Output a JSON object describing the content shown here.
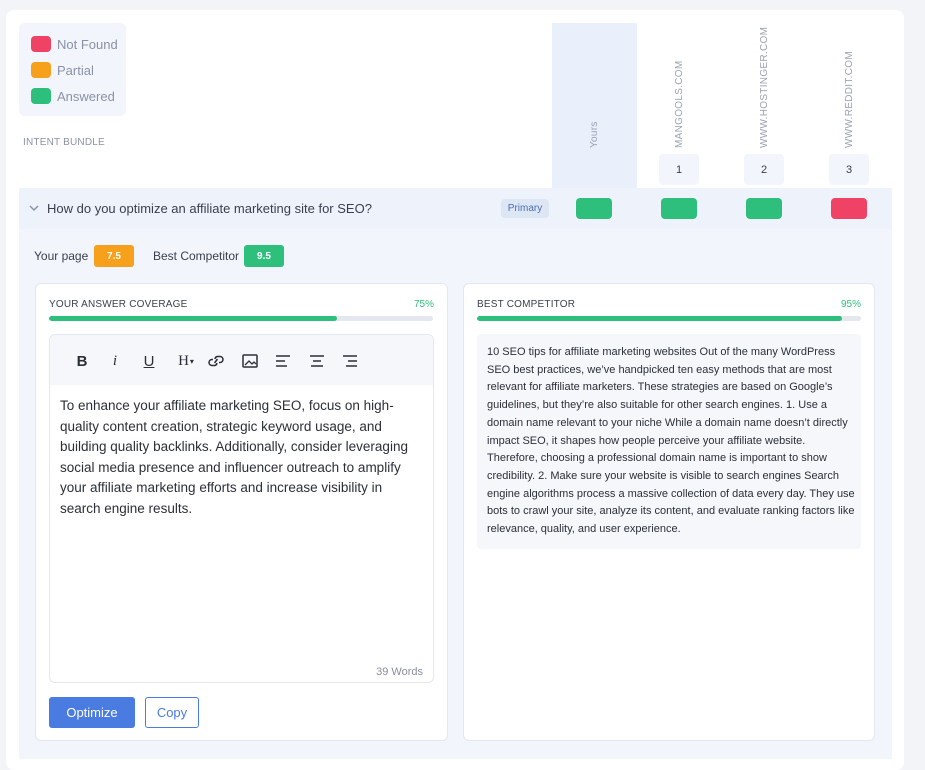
{
  "legend": {
    "items": [
      {
        "label": "Not Found",
        "color": "#ef4264"
      },
      {
        "label": "Partial",
        "color": "#f7a01c"
      },
      {
        "label": "Answered",
        "color": "#2fbf7c"
      }
    ]
  },
  "intent_bundle_label": "INTENT BUNDLE",
  "columns": {
    "yours": "Yours",
    "competitors": [
      {
        "site": "MANGOOLS.COM",
        "rank": "1"
      },
      {
        "site": "WWW.HOSTINGER.COM",
        "rank": "2"
      },
      {
        "site": "WWW.REDDIT.COM",
        "rank": "3"
      }
    ]
  },
  "question": {
    "text": "How do you optimize an affiliate marketing site for SEO?",
    "badge": "Primary",
    "statuses": [
      "answered",
      "answered",
      "answered",
      "not-found"
    ]
  },
  "scores": {
    "your_page_label": "Your page",
    "your_page_score": "7.5",
    "best_competitor_label": "Best Competitor",
    "best_competitor_score": "9.5"
  },
  "answer_panel": {
    "title": "YOUR ANSWER COVERAGE",
    "percent_label": "75%",
    "coverage": 0.75,
    "toolbar": [
      "bold-icon",
      "italic-icon",
      "underline-icon",
      "heading-icon",
      "link-icon",
      "image-icon",
      "align-left-icon",
      "align-center-icon",
      "align-right-icon"
    ],
    "text": "To enhance your affiliate marketing SEO, focus on high-quality content creation, strategic keyword usage, and building quality backlinks. Additionally, consider leveraging social media presence and influencer outreach to amplify your affiliate marketing efforts and increase visibility in search engine results.",
    "word_count": "39 Words",
    "optimize_label": "Optimize",
    "copy_label": "Copy"
  },
  "competitor_panel": {
    "title": "BEST COMPETITOR",
    "percent_label": "95%",
    "coverage": 0.95,
    "text": "10 SEO tips for affiliate marketing websites Out of the many WordPress SEO best practices, we’ve handpicked ten easy methods that are most relevant for affiliate marketers. These strategies are based on Google’s guidelines, but they’re also suitable for other search engines. 1. Use a domain name relevant to your niche While a domain name doesn’t directly impact SEO, it shapes how people perceive your affiliate website. Therefore, choosing a professional domain name is important to show credibility. 2. Make sure your website is visible to search engines Search engine algorithms process a massive collection of data every day. They use bots to crawl your site, analyze its content, and evaluate ranking factors like relevance, quality, and user experience."
  },
  "colors": {
    "answered": "#2fbf7c",
    "partial": "#f7a01c",
    "not_found": "#ef4264",
    "primary_button": "#4a7be0"
  }
}
